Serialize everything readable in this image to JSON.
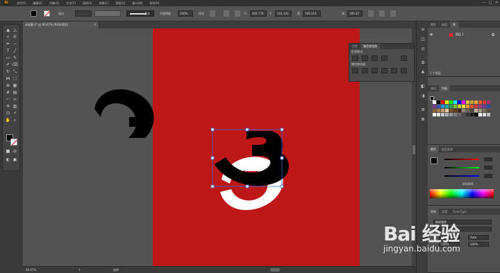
{
  "app": {
    "logo": "Ai"
  },
  "menubar": {
    "items": [
      "文件(F)",
      "编辑(E)",
      "对象(O)",
      "文字(T)",
      "选择(S)",
      "效果(C)",
      "视图(V)",
      "窗口(W)",
      "帮助(H)"
    ],
    "window_controls": [
      "—",
      "□",
      "✕"
    ]
  },
  "control_bar": {
    "stroke_label": "描边",
    "uniform_label": "基本",
    "opacity_label": "不透明度",
    "opacity_value": "100%",
    "style_label": "样式",
    "x_label": "X:",
    "x_value": "405.776",
    "y_label": "Y:",
    "y_value": "331.101",
    "w_label": "宽:",
    "w_value": "190.113",
    "h_label": "高:",
    "h_value": "195.22"
  },
  "document": {
    "tab_title": "未标题-1* @ 66.67% (RGB/预览)",
    "close": "×"
  },
  "pathfinder_panel": {
    "tabs": [
      "对齐",
      "路径查找器"
    ],
    "active_tab": 1,
    "shape_modes_label": "形状模式:",
    "pathfinders_label": "路径查找器:"
  },
  "layers_panel": {
    "tabs": [
      "属性",
      "图层",
      "库"
    ],
    "active_tab": 1,
    "layer_name": "图层 1",
    "layer_color": "#ff2233",
    "footer": "1 个图层"
  },
  "swatches_panel": {
    "tabs": [
      "描边",
      "色板"
    ],
    "active_tab": 1
  },
  "color_panel": {
    "tabs": [
      "颜色",
      "颜色参考"
    ],
    "hex_value": "000000"
  },
  "character_panel": {
    "tabs": [
      "字符",
      "段落",
      "OpenType"
    ],
    "font_label": "微软雅黑",
    "size_value": "18 pt",
    "leading_value": "Auto",
    "scale_value": "100%"
  },
  "status_bar": {
    "zoom": "66.67%",
    "page": "1",
    "tool": "选择"
  },
  "watermark": {
    "brand": "Bai  经验",
    "url": "jingyan.baidu.com"
  },
  "colors": {
    "artboard": "#be1717",
    "canvas": "#535353",
    "glyph_black": "#000000",
    "glyph_white": "#ffffff",
    "selection": "#3a6cd6"
  },
  "swatch_colors": [
    "#ffffff",
    "#000000",
    "#ff0000",
    "#ffff00",
    "#00ff00",
    "#00ffff",
    "#0000ff",
    "#ff00ff",
    "#e8c14a",
    "#c9a23a",
    "#f2a33a",
    "#e25d25",
    "#d63a3a",
    "#b52a6a",
    "#7f3a96",
    "#3a55a8",
    "#1f8fd6",
    "#23a8a2",
    "#27a253",
    "#7dbb2e",
    "#c8d13a",
    "#f5e04a",
    "#f29b2b",
    "#e2582a",
    "#cf3b3b",
    "#a63a7a",
    "#6b3b95",
    "#2f4aa0",
    "#8c6239",
    "#a67c52",
    "#c69c6d",
    "#e8c9a0",
    "#754c24",
    "#603813",
    "#42210b",
    "#998675",
    "#736357",
    "#534741",
    "#c7b299",
    "#a89880",
    "#7a6a58",
    "#5a4a3a",
    "#ffffff",
    "#e6e6e6",
    "#cccccc",
    "#b3b3b3",
    "#999999",
    "#808080",
    "#666666",
    "#4d4d4d",
    "#333333",
    "#1a1a1a",
    "#000000",
    "#f0f0f0",
    "#d9d9d9",
    "#bfbfbf"
  ]
}
